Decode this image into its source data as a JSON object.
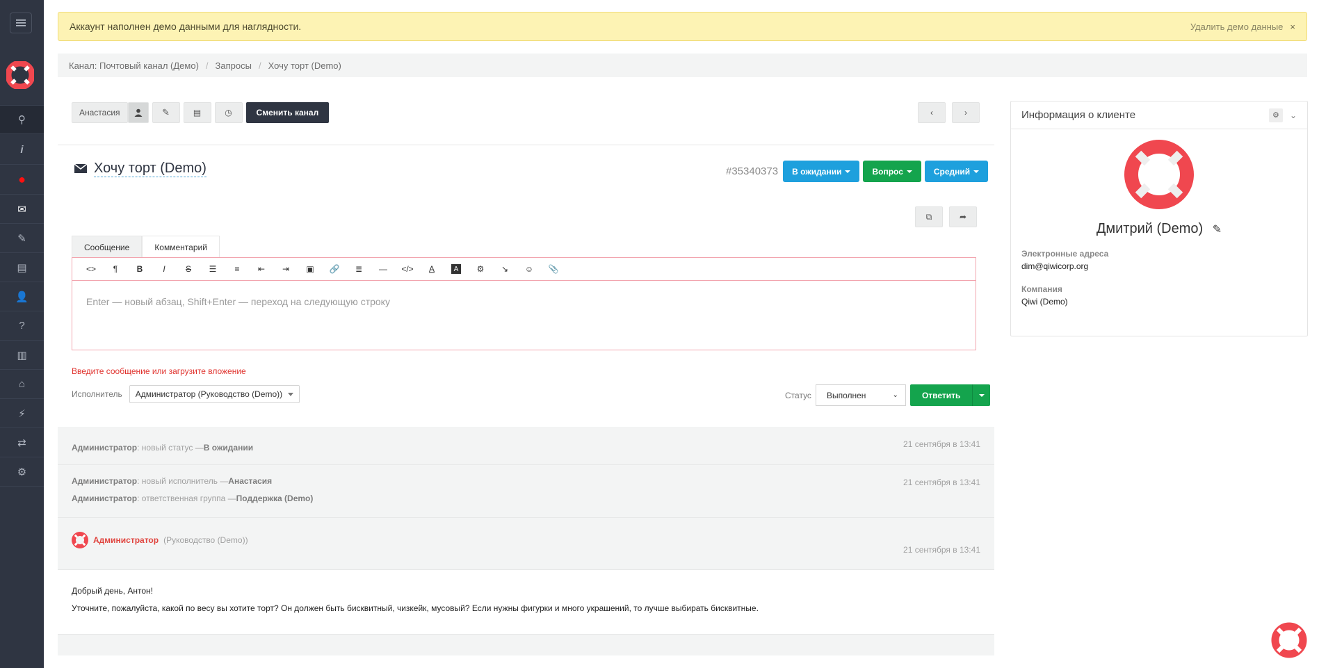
{
  "colors": {
    "sidebar": "#2f3542",
    "accent_blue": "#1ea0dd",
    "accent_green": "#14a44d",
    "error": "#e0332e",
    "banner": "#fdf3b4",
    "logo_red": "#f0474f"
  },
  "sidebar": {
    "items": [
      {
        "icon": "search-icon",
        "glyph": "⚲"
      },
      {
        "icon": "info-icon",
        "glyph": "i"
      },
      {
        "icon": "record-icon",
        "glyph": "●"
      },
      {
        "icon": "envelope-icon",
        "glyph": "✉"
      },
      {
        "icon": "tags-icon",
        "glyph": "✎"
      },
      {
        "icon": "list-icon",
        "glyph": "▤"
      },
      {
        "icon": "user-icon",
        "glyph": "👤"
      },
      {
        "icon": "help-icon",
        "glyph": "?"
      },
      {
        "icon": "document-icon",
        "glyph": "▥"
      },
      {
        "icon": "inbox-icon",
        "glyph": "⌂"
      },
      {
        "icon": "bolt-icon",
        "glyph": "⚡"
      },
      {
        "icon": "toggles-icon",
        "glyph": "⇄"
      },
      {
        "icon": "gear-icon",
        "glyph": "⚙"
      }
    ]
  },
  "banner": {
    "text": "Аккаунт наполнен демо данными для наглядности.",
    "remove_label": "Удалить демо данные",
    "close_glyph": "×"
  },
  "breadcrumb": {
    "items": [
      "Канал: Почтовый канал (Демо)",
      "Запросы",
      "Хочу торт (Demo)"
    ],
    "separator": "/"
  },
  "toolbar": {
    "assignee": "Анастасия",
    "change_channel": "Сменить канал",
    "prev": "‹",
    "next": "›"
  },
  "ticket": {
    "title": "Хочу торт (Demo)",
    "id": "#35340373",
    "status": "В ожидании",
    "type": "Вопрос",
    "priority": "Средний"
  },
  "tabs": {
    "message": "Сообщение",
    "comment": "Комментарий"
  },
  "editor": {
    "placeholder": "Enter — новый абзац, Shift+Enter — переход на следующую строку",
    "tools": [
      "<>",
      "¶",
      "B",
      "I",
      "S",
      "☰",
      "≡",
      "⇤",
      "⇥",
      "▣",
      "🔗",
      "≣",
      "—",
      "</>",
      "A",
      "A",
      "⚙",
      "↘",
      "☺",
      "📎"
    ]
  },
  "error": "Введите сообщение или загрузите вложение",
  "assignee": {
    "label": "Исполнитель",
    "value": "Администратор (Руководство (Demo))"
  },
  "status": {
    "label": "Статус",
    "value": "Выполнен"
  },
  "reply": {
    "label": "Ответить"
  },
  "history": {
    "events": [
      {
        "lines": [
          {
            "actor": "Администратор",
            "text": ": новый статус — ",
            "value": "В ожидании"
          }
        ],
        "time": "21 сентября в 13:41"
      },
      {
        "lines": [
          {
            "actor": "Администратор",
            "text": ": новый исполнитель — ",
            "value": "Анастасия"
          },
          {
            "actor": "Администратор",
            "text": ": ответственная группа — ",
            "value": "Поддержка (Demo)"
          }
        ],
        "time": "21 сентября в 13:41"
      }
    ],
    "message": {
      "author": "Администратор",
      "role": "(Руководство (Demo))",
      "time": "21 сентября в 13:41",
      "lines": [
        "Добрый день, Антон!",
        "Уточните, пожалуйста, какой по весу вы хотите торт? Он должен быть бисквитный, чизкейк, мусовый? Если нужны фигурки и много украшений, то лучше выбирать бисквитные."
      ]
    }
  },
  "client": {
    "header": "Информация о клиенте",
    "name": "Дмитрий (Demo)",
    "email_label": "Электронные адреса",
    "email": "dim@qiwicorp.org",
    "company_label": "Компания",
    "company": "Qiwi (Demo)"
  }
}
